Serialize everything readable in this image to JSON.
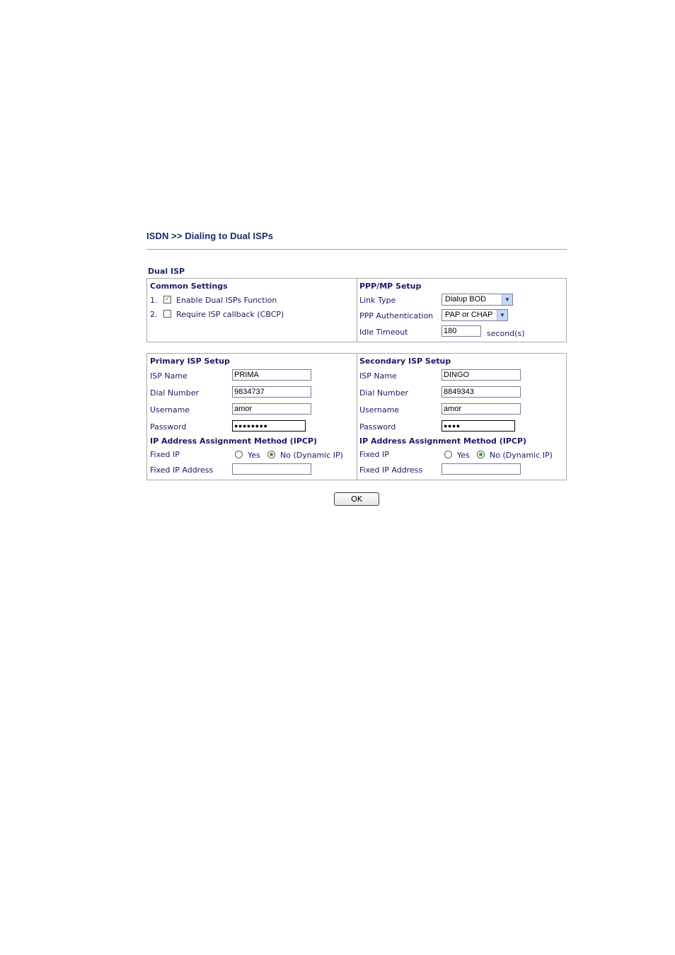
{
  "page": {
    "title": "ISDN >> Dialing to Dual ISPs",
    "section": "Dual ISP"
  },
  "common": {
    "header": "Common Settings",
    "items": [
      {
        "num": "1.",
        "label": "Enable Dual ISPs Function",
        "checked": true
      },
      {
        "num": "2.",
        "label": "Require ISP callback (CBCP)",
        "checked": false
      }
    ]
  },
  "ppp": {
    "header": "PPP/MP Setup",
    "link_type_label": "Link Type",
    "link_type_value": "Dialup BOD",
    "auth_label": "PPP Authentication",
    "auth_value": "PAP or CHAP",
    "idle_label": "Idle Timeout",
    "idle_value": "180",
    "idle_unit": "second(s)"
  },
  "primary": {
    "header": "Primary ISP Setup",
    "isp_name_label": "ISP Name",
    "isp_name": "PRIMA",
    "dial_label": "Dial Number",
    "dial": "9834737",
    "user_label": "Username",
    "user": "amor",
    "pass_label": "Password",
    "pass": "●●●●●●●●",
    "ip_header": "IP Address Assignment Method (IPCP)",
    "fixed_ip_label": "Fixed IP",
    "yes_label": "Yes",
    "no_label": "No (Dynamic IP)",
    "fixed_ip_selected": "no",
    "fixed_addr_label": "Fixed IP Address",
    "fixed_addr": ""
  },
  "secondary": {
    "header": "Secondary ISP Setup",
    "isp_name_label": "ISP Name",
    "isp_name": "DINGO",
    "dial_label": "Dial Number",
    "dial": "8849343",
    "user_label": "Username",
    "user": "amor",
    "pass_label": "Password",
    "pass": "●●●●",
    "ip_header": "IP Address Assignment Method (IPCP)",
    "fixed_ip_label": "Fixed IP",
    "yes_label": "Yes",
    "no_label": "No (Dynamic IP)",
    "fixed_ip_selected": "no",
    "fixed_addr_label": "Fixed IP Address",
    "fixed_addr": ""
  },
  "actions": {
    "ok": "OK"
  },
  "icons": {
    "checkbox_checked": "check-mark-icon",
    "select_arrow": "chevron-down-icon"
  }
}
